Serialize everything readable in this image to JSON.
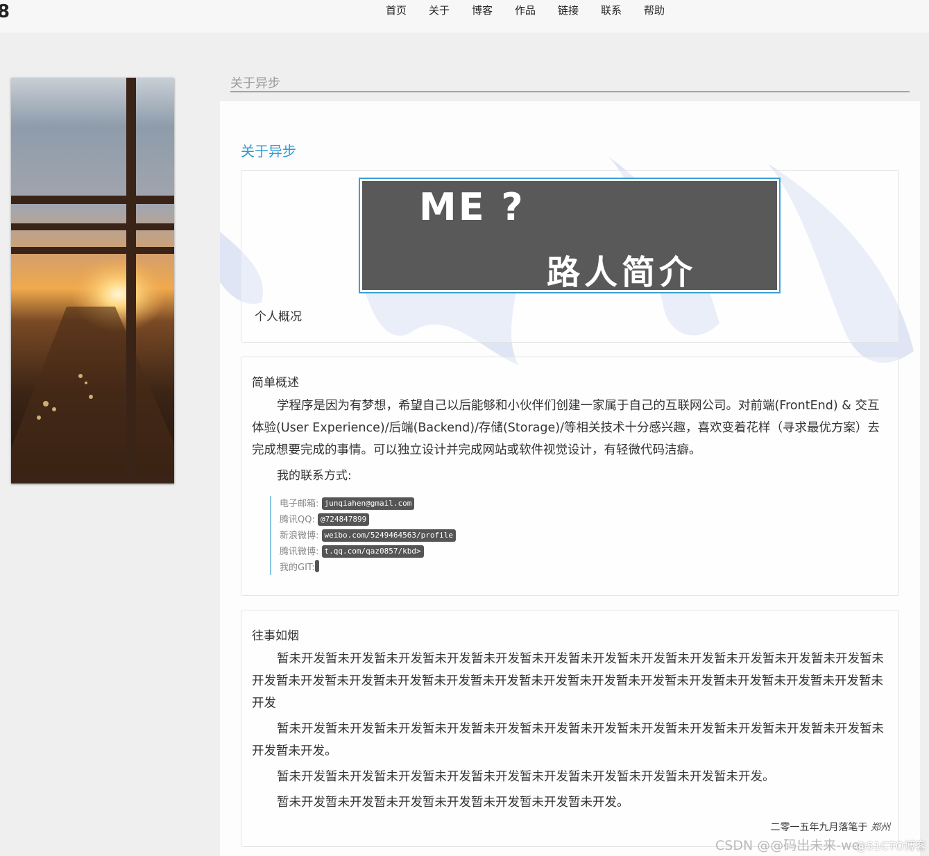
{
  "header": {
    "logo": "8",
    "nav": [
      "首页",
      "关于",
      "博客",
      "作品",
      "链接",
      "联系",
      "帮助"
    ]
  },
  "page_heading": "关于异步",
  "section_title": "关于异步",
  "banner": {
    "line1": "ME ?",
    "line2": "路人简介"
  },
  "overview_label": "个人概况",
  "summary": {
    "title": "简单概述",
    "paragraph": "学程序是因为有梦想，希望自己以后能够和小伙伴们创建一家属于自己的互联网公司。对前端(FrontEnd) & 交互体验(User Experience)/后端(Backend)/存储(Storage)/等相关技术十分感兴趣，喜欢变着花样（寻求最优方案）去完成想要完成的事情。可以独立设计并完成网站或软件视觉设计，有轻微代码洁癖。",
    "contact_label": "我的联系方式:",
    "contacts": [
      {
        "label": "电子邮箱:",
        "value": "junqiahen@gmail.com"
      },
      {
        "label": "腾讯QQ:",
        "value": "@724847899"
      },
      {
        "label": "新浪微博:",
        "value": "weibo.com/5249464563/profile"
      },
      {
        "label": "腾讯微博:",
        "value": "t.qq.com/qaz0857/kbd>"
      },
      {
        "label": "我的GIT:",
        "value": ""
      }
    ]
  },
  "past": {
    "title": "往事如烟",
    "paragraphs": [
      "暂未开发暂未开发暂未开发暂未开发暂未开发暂未开发暂未开发暂未开发暂未开发暂未开发暂未开发暂未开发暂未开发暂未开发暂未开发暂未开发暂未开发暂未开发暂未开发暂未开发暂未开发暂未开发暂未开发暂未开发暂未开发暂未开发",
      "暂未开发暂未开发暂未开发暂未开发暂未开发暂未开发暂未开发暂未开发暂未开发暂未开发暂未开发暂未开发暂未开发暂未开发。",
      "暂未开发暂未开发暂未开发暂未开发暂未开发暂未开发暂未开发暂未开发暂未开发暂未开发。",
      "暂未开发暂未开发暂未开发暂未开发暂未开发暂未开发暂未开发。"
    ],
    "signature": "二零一五年九月落笔于",
    "signature_place": "郑州"
  },
  "watermark_text": "CSDN @@码出未来-we",
  "watermark_text2": "@51CTO博客"
}
